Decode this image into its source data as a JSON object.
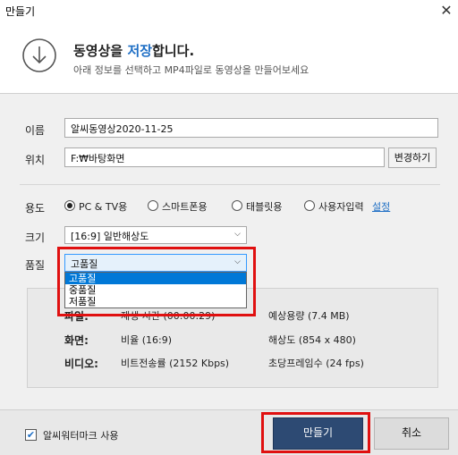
{
  "window": {
    "title": "만들기",
    "close_glyph": "✕"
  },
  "header": {
    "title_prefix": "동영상을 ",
    "title_accent": "저장",
    "title_suffix": "합니다.",
    "subtitle": "아래 정보를 선택하고 MP4파일로 동영상을 만들어보세요",
    "accent_color": "#1f6fc5"
  },
  "form": {
    "name_label": "이름",
    "name_value": "알씨동영상2020-11-25",
    "location_label": "위치",
    "location_value": "F:₩바탕화면",
    "change_button": "변경하기",
    "usage_label": "용도",
    "usage_options": [
      {
        "label": "PC & TV용",
        "selected": true
      },
      {
        "label": "스마트폰용",
        "selected": false
      },
      {
        "label": "태블릿용",
        "selected": false
      },
      {
        "label": "사용자입력",
        "selected": false
      }
    ],
    "settings_link": "설정",
    "size_label": "크기",
    "size_value": "[16:9] 일반해상도",
    "quality_label": "품질",
    "quality_value": "고품질",
    "quality_options": [
      "고품질",
      "중품질",
      "저품질"
    ],
    "quality_selected_index": 0
  },
  "info": {
    "file_key": "파일:",
    "play_time": "재생 시간 (00:00:29)",
    "expected_size": "예상용량 (7.4 MB)",
    "screen_key": "화면:",
    "ratio": "비율 (16:9)",
    "resolution": "해상도 (854 x 480)",
    "video_key": "비디오:",
    "bitrate": "비트전송률 (2152 Kbps)",
    "fps": "초당프레임수 (24 fps)"
  },
  "footer": {
    "watermark_label": "알씨워터마크 사용",
    "watermark_checked": true,
    "make_button": "만들기",
    "cancel_button": "취소"
  },
  "highlight_color": "#e01010"
}
